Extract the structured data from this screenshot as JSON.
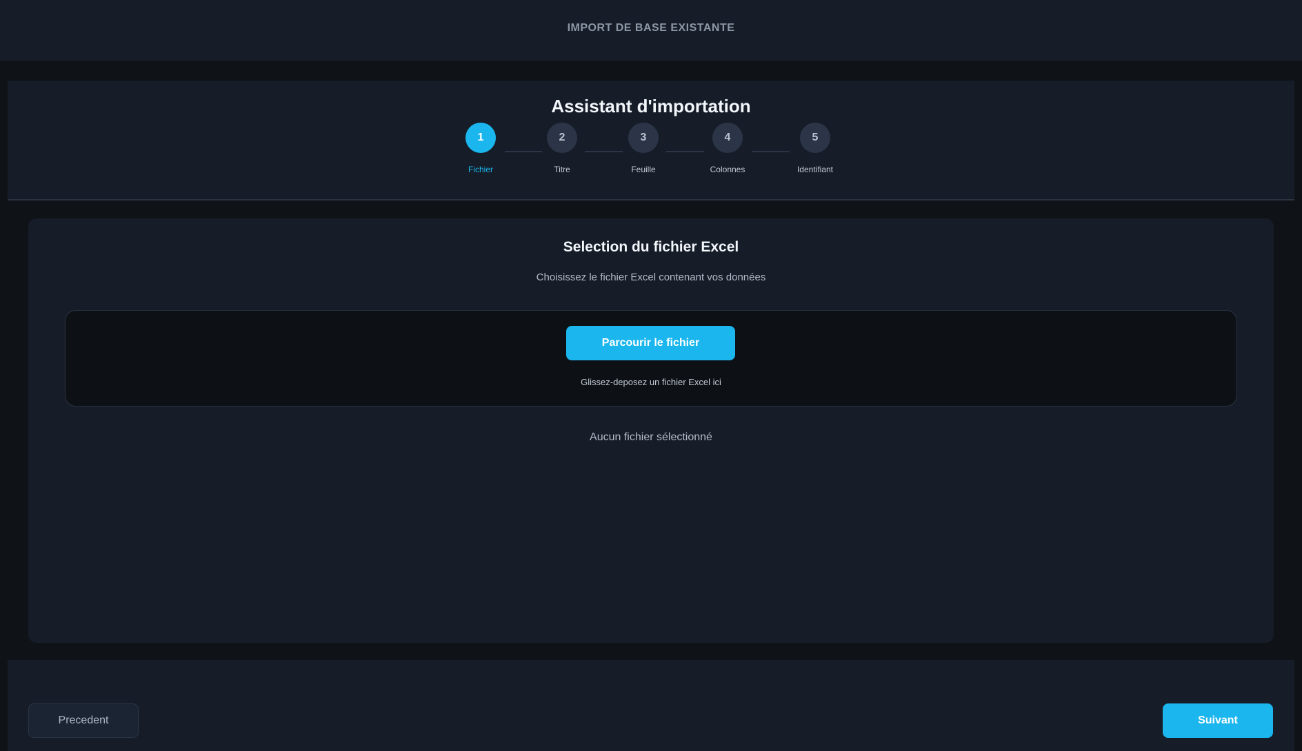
{
  "topbar": {
    "title": "IMPORT DE BASE EXISTANTE"
  },
  "wizard": {
    "title": "Assistant d'importation",
    "active_step": 1,
    "steps": [
      {
        "number": "1",
        "label": "Fichier"
      },
      {
        "number": "2",
        "label": "Titre"
      },
      {
        "number": "3",
        "label": "Feuille"
      },
      {
        "number": "4",
        "label": "Colonnes"
      },
      {
        "number": "5",
        "label": "Identifiant"
      }
    ]
  },
  "card": {
    "title": "Selection du fichier Excel",
    "subtitle": "Choisissez le fichier Excel contenant vos données",
    "browse_label": "Parcourir le fichier",
    "drop_hint": "Glissez-deposez un fichier Excel ici",
    "file_status": "Aucun fichier sélectionné"
  },
  "footer": {
    "prev_label": "Precedent",
    "next_label": "Suivant"
  },
  "colors": {
    "accent": "#1bb6ee",
    "panel": "#161d28",
    "background": "#0f1217"
  }
}
